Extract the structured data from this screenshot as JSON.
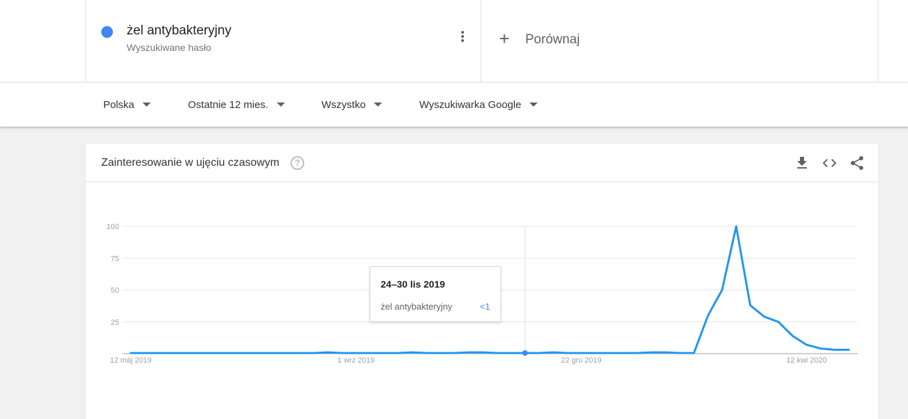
{
  "term": {
    "name": "żel antybakteryjny",
    "subtitle": "Wyszukiwane hasło",
    "color": "#4285f4"
  },
  "compare_label": "Porównaj",
  "filters": [
    "Polska",
    "Ostatnie 12 mies.",
    "Wszystko",
    "Wyszukiwarka Google"
  ],
  "card": {
    "title": "Zainteresowanie w ujęciu czasowym",
    "help_glyph": "?",
    "tools": [
      "download-icon",
      "embed-code-icon",
      "share-icon"
    ]
  },
  "tooltip": {
    "title": "24–30 lis 2019",
    "term": "żel antybakteryjny",
    "value": "<1"
  },
  "chart_data": {
    "type": "line",
    "ylim": [
      0,
      100
    ],
    "yticks": [
      100,
      75,
      50,
      25
    ],
    "xtick_labels": [
      "12 maj 2019",
      "1 wrz 2019",
      "22 gru 2019",
      "12 kwi 2020"
    ],
    "xtick_weeks": [
      0,
      16,
      32,
      48
    ],
    "highlight_week": 28,
    "series": [
      {
        "name": "żel antybakteryjny",
        "color": "#2196f3",
        "values": [
          0.5,
          0.5,
          0.5,
          0.5,
          0.5,
          0.5,
          0.5,
          0.5,
          0.5,
          0.5,
          0.5,
          0.5,
          0.5,
          0.5,
          1,
          0.5,
          0.5,
          0.5,
          0.5,
          0.5,
          1,
          0.5,
          0.5,
          0.5,
          1,
          1,
          0.5,
          0.5,
          0.5,
          0.5,
          1,
          0.5,
          0.5,
          0.5,
          0.5,
          0.5,
          0.5,
          1,
          1,
          0.5,
          0.5,
          30,
          50,
          100,
          38,
          29,
          25,
          14,
          7,
          4,
          3,
          3
        ]
      }
    ]
  }
}
